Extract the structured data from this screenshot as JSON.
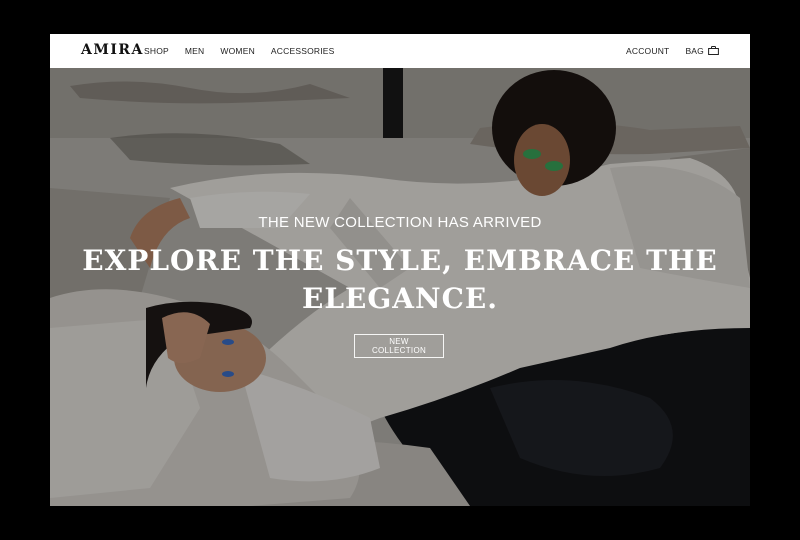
{
  "header": {
    "logo": "AMIRA",
    "nav_left": [
      "SHOP",
      "MEN",
      "WOMEN",
      "ACCESSORIES"
    ],
    "account_label": "ACCOUNT",
    "bag_label": "BAG"
  },
  "hero": {
    "subtitle": "THE NEW COLLECTION HAS ARRIVED",
    "headline_line1": "EXPLORE THE STYLE, EMBRACE THE",
    "headline_line2": "ELEGANCE.",
    "cta_label": "NEW COLLECTION"
  },
  "icons": {
    "bag": "shopping-bag-icon"
  },
  "colors": {
    "page_background": "#000000",
    "header_background": "#ffffff",
    "text_dark": "#111111",
    "hero_text": "#ffffff"
  }
}
